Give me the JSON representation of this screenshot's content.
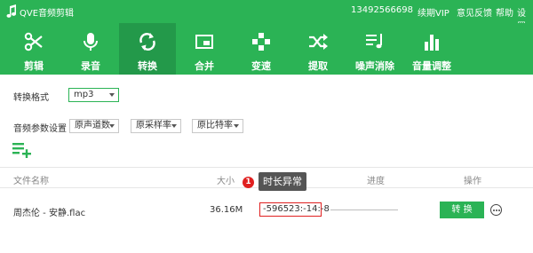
{
  "titlebar": {
    "app_name": "QVE音频剪辑",
    "phone": "13492566698",
    "renew_vip": "续期VIP",
    "feedback": "意见反馈",
    "help": "帮助",
    "settings": "设置",
    "color": "#2bb355"
  },
  "toolbar": {
    "items": [
      {
        "label": "剪辑",
        "icon": "scissors-icon"
      },
      {
        "label": "录音",
        "icon": "microphone-icon"
      },
      {
        "label": "转换",
        "icon": "convert-icon",
        "active": true
      },
      {
        "label": "合并",
        "icon": "merge-icon"
      },
      {
        "label": "变速",
        "icon": "speed-icon"
      },
      {
        "label": "提取",
        "icon": "extract-icon"
      },
      {
        "label": "噪声消除",
        "icon": "noise-removal-icon"
      },
      {
        "label": "音量调整",
        "icon": "volume-icon"
      }
    ]
  },
  "settings": {
    "format_label": "转换格式",
    "format_value": "mp3",
    "params_label": "音频参数设置",
    "channels_value": "原声道数",
    "samplerate_value": "原采样率",
    "bitrate_value": "原比特率"
  },
  "table": {
    "headers": {
      "filename": "文件名称",
      "size": "大小",
      "progress": "进度",
      "actions": "操作"
    },
    "rows": [
      {
        "filename": "周杰伦 - 安静.flac",
        "size": "36.16M",
        "duration": "-596523:-14:-8",
        "action": "转 换"
      }
    ]
  },
  "annotation": {
    "number": "1",
    "text": "时长异常",
    "color": "#e02020"
  }
}
